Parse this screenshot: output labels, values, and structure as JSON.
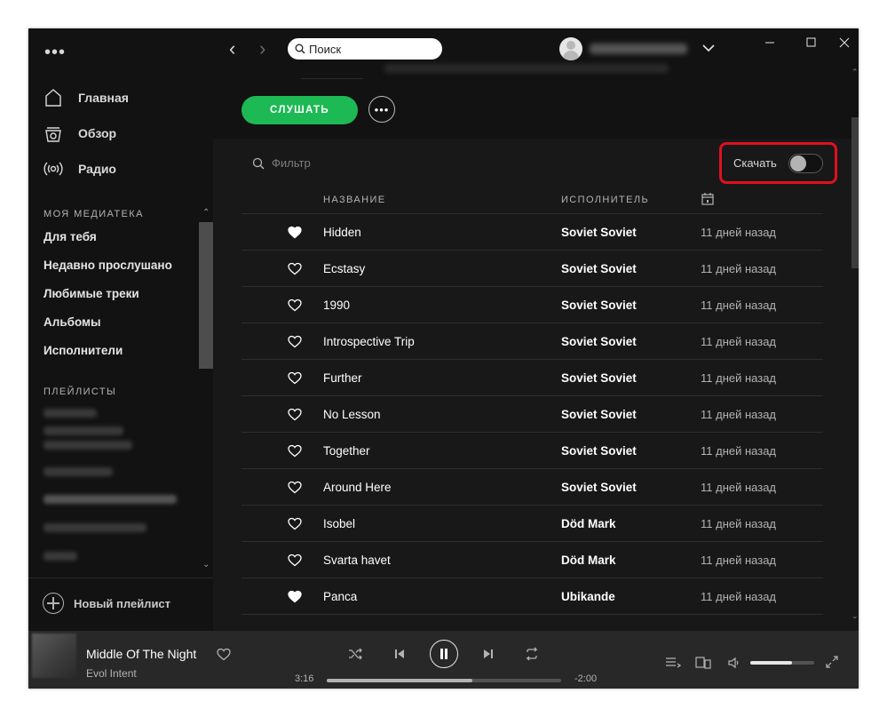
{
  "window": {
    "minimize_glyph": "—",
    "maximize_glyph": "☐",
    "close_glyph": "✕"
  },
  "sidebar": {
    "menu_glyph": "•••",
    "nav": [
      {
        "label": "Главная",
        "icon": "home-icon"
      },
      {
        "label": "Обзор",
        "icon": "browse-icon"
      },
      {
        "label": "Радио",
        "icon": "radio-icon"
      }
    ],
    "library_title": "МОЯ МЕДИАТЕКА",
    "library": [
      "Для тебя",
      "Недавно прослушано",
      "Любимые треки",
      "Альбомы",
      "Исполнители"
    ],
    "playlists_title": "ПЛЕЙЛИСТЫ",
    "new_playlist": "Новый плейлист"
  },
  "topbar": {
    "search_placeholder": "Поиск",
    "back_glyph": "‹",
    "forward_glyph": "›"
  },
  "actions": {
    "listen": "СЛУШАТЬ",
    "more_glyph": "•••",
    "filter_placeholder": "Фильтр",
    "download_label": "Скачать",
    "download_enabled": false
  },
  "table": {
    "headers": {
      "title": "НАЗВАНИЕ",
      "artist": "ИСПОЛНИТЕЛЬ",
      "date_icon": "calendar-icon"
    },
    "rows": [
      {
        "title": "Hidden",
        "artist": "Soviet Soviet",
        "date": "11 дней назад",
        "liked": true
      },
      {
        "title": "Ecstasy",
        "artist": "Soviet Soviet",
        "date": "11 дней назад",
        "liked": false
      },
      {
        "title": "1990",
        "artist": "Soviet Soviet",
        "date": "11 дней назад",
        "liked": false
      },
      {
        "title": "Introspective Trip",
        "artist": "Soviet Soviet",
        "date": "11 дней назад",
        "liked": false
      },
      {
        "title": "Further",
        "artist": "Soviet Soviet",
        "date": "11 дней назад",
        "liked": false
      },
      {
        "title": "No Lesson",
        "artist": "Soviet Soviet",
        "date": "11 дней назад",
        "liked": false
      },
      {
        "title": "Together",
        "artist": "Soviet Soviet",
        "date": "11 дней назад",
        "liked": false
      },
      {
        "title": "Around Here",
        "artist": "Soviet Soviet",
        "date": "11 дней назад",
        "liked": false
      },
      {
        "title": "Isobel",
        "artist": "Död Mark",
        "date": "11 дней назад",
        "liked": false
      },
      {
        "title": "Svarta havet",
        "artist": "Död Mark",
        "date": "11 дней назад",
        "liked": false
      },
      {
        "title": "Panca",
        "artist": "Ubikande",
        "date": "11 дней назад",
        "liked": true
      }
    ]
  },
  "player": {
    "track_title": "Middle Of The Night",
    "track_artist": "Evol Intent",
    "time_current": "3:16",
    "time_remaining": "-2:00",
    "progress": 0.62,
    "volume": 0.65
  },
  "colors": {
    "accent": "#1db954",
    "highlight": "#e0101f",
    "background": "#121212",
    "main_bg": "#181818",
    "player_bg": "#282828"
  }
}
